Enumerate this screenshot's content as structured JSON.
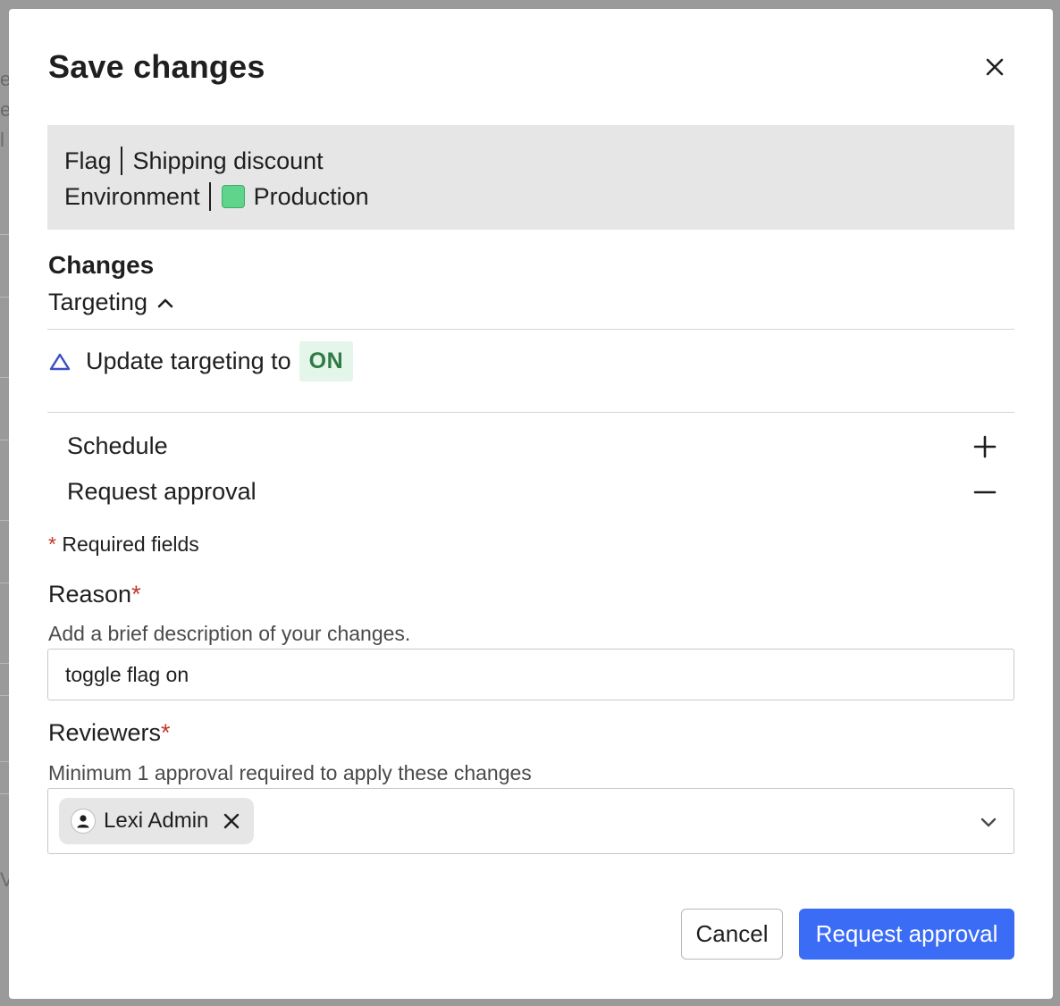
{
  "dialog": {
    "title": "Save changes"
  },
  "summary": {
    "flag_label": "Flag",
    "flag_name": "Shipping discount",
    "environment_label": "Environment",
    "environment_name": "Production",
    "environment_color": "#5fd48a"
  },
  "changes": {
    "heading": "Changes",
    "section_toggle": "Targeting",
    "update_text": "Update targeting to",
    "update_value": "ON"
  },
  "options": {
    "schedule_label": "Schedule",
    "request_approval_label": "Request approval"
  },
  "form": {
    "required_star": "*",
    "required_note": "Required fields",
    "reason_label": "Reason",
    "reason_help": "Add a brief description of your changes.",
    "reason_value": "toggle flag on",
    "reviewers_label": "Reviewers",
    "reviewers_help": "Minimum 1 approval required to apply these changes",
    "reviewers_selected": [
      "Lexi Admin"
    ]
  },
  "footer": {
    "cancel_label": "Cancel",
    "submit_label": "Request approval"
  },
  "colors": {
    "primary": "#3b6cf5",
    "on_badge_bg": "#e4f5e9",
    "on_badge_text": "#2f7a45",
    "required": "#c0392b"
  }
}
